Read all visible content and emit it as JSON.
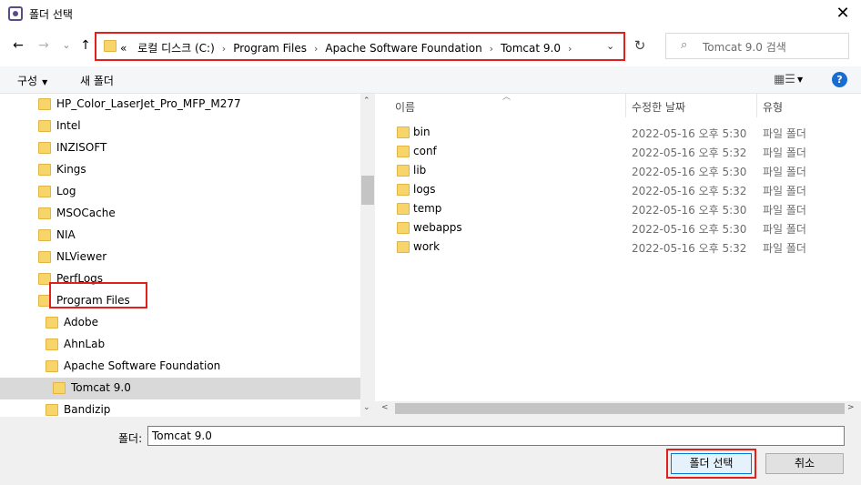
{
  "window": {
    "title": "폴더 선택",
    "close_glyph": "✕"
  },
  "nav": {
    "back": "←",
    "forward": "→",
    "recent": "⌄",
    "up": "↑",
    "refresh": "↻"
  },
  "address": {
    "overflow": "«",
    "crumbs": [
      "로컬 디스크 (C:)",
      "Program Files",
      "Apache Software Foundation",
      "Tomcat 9.0"
    ],
    "separator": "›"
  },
  "search": {
    "placeholder": "Tomcat 9.0 검색"
  },
  "toolbar": {
    "organize": "구성",
    "new_folder": "새 폴더",
    "help": "?"
  },
  "tree": {
    "items": [
      {
        "label": "HP_Color_LaserJet_Pro_MFP_M277",
        "level": 0
      },
      {
        "label": "Intel",
        "level": 0
      },
      {
        "label": "INZISOFT",
        "level": 0
      },
      {
        "label": "Kings",
        "level": 0
      },
      {
        "label": "Log",
        "level": 0
      },
      {
        "label": "MSOCache",
        "level": 0
      },
      {
        "label": "NIA",
        "level": 0
      },
      {
        "label": "NLViewer",
        "level": 0
      },
      {
        "label": "PerfLogs",
        "level": 0
      },
      {
        "label": "Program Files",
        "level": 0
      },
      {
        "label": "Adobe",
        "level": 1
      },
      {
        "label": "AhnLab",
        "level": 1
      },
      {
        "label": "Apache Software Foundation",
        "level": 1
      },
      {
        "label": "Tomcat 9.0",
        "level": 2,
        "selected": true
      },
      {
        "label": "Bandizip",
        "level": 1
      }
    ]
  },
  "columns": {
    "name": "이름",
    "modified": "수정한 날짜",
    "type": "유형"
  },
  "files": [
    {
      "name": "bin",
      "date": "2022-05-16 오후 5:30",
      "type": "파일 폴더"
    },
    {
      "name": "conf",
      "date": "2022-05-16 오후 5:32",
      "type": "파일 폴더"
    },
    {
      "name": "lib",
      "date": "2022-05-16 오후 5:30",
      "type": "파일 폴더"
    },
    {
      "name": "logs",
      "date": "2022-05-16 오후 5:32",
      "type": "파일 폴더"
    },
    {
      "name": "temp",
      "date": "2022-05-16 오후 5:30",
      "type": "파일 폴더"
    },
    {
      "name": "webapps",
      "date": "2022-05-16 오후 5:30",
      "type": "파일 폴더"
    },
    {
      "name": "work",
      "date": "2022-05-16 오후 5:32",
      "type": "파일 폴더"
    }
  ],
  "footer": {
    "folder_label": "폴더:",
    "folder_value": "Tomcat 9.0",
    "ok_label": "폴더 선택",
    "cancel_label": "취소"
  },
  "colors": {
    "highlight_outline": "#e0201a",
    "folder_fill": "#f8d56b",
    "selection_bg": "#d9d9d9",
    "help_blue": "#1a6cd1"
  }
}
